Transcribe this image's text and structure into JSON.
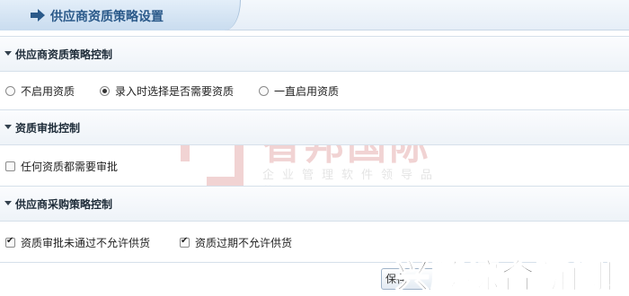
{
  "header": {
    "title": "供应商资质策略设置"
  },
  "sections": {
    "supplier_qual": {
      "title": "供应商资质策略控制",
      "options": [
        {
          "label": "不启用资质",
          "checked": false
        },
        {
          "label": "录入时选择是否需要资质",
          "checked": true
        },
        {
          "label": "一直启用资质",
          "checked": false
        }
      ]
    },
    "qual_approval": {
      "title": "资质审批控制",
      "options": [
        {
          "label": "任何资质都需要审批",
          "checked": false
        }
      ]
    },
    "purchase_policy": {
      "title": "供应商采购策略控制",
      "options": [
        {
          "label": "资质审批未通过不允许供货",
          "checked": true
        },
        {
          "label": "资质过期不允许供货",
          "checked": true
        }
      ]
    }
  },
  "footer": {
    "save_label": "保存"
  },
  "watermark": {
    "title": "智邦国际",
    "subtitle": "企业管理软件领导品牌"
  },
  "overlay": {
    "text": "兴顺综合新闻网"
  },
  "colors": {
    "title_text": "#2b5a8a",
    "watermark_red": "#c23a3a",
    "arrow": "#2b5a8a"
  }
}
